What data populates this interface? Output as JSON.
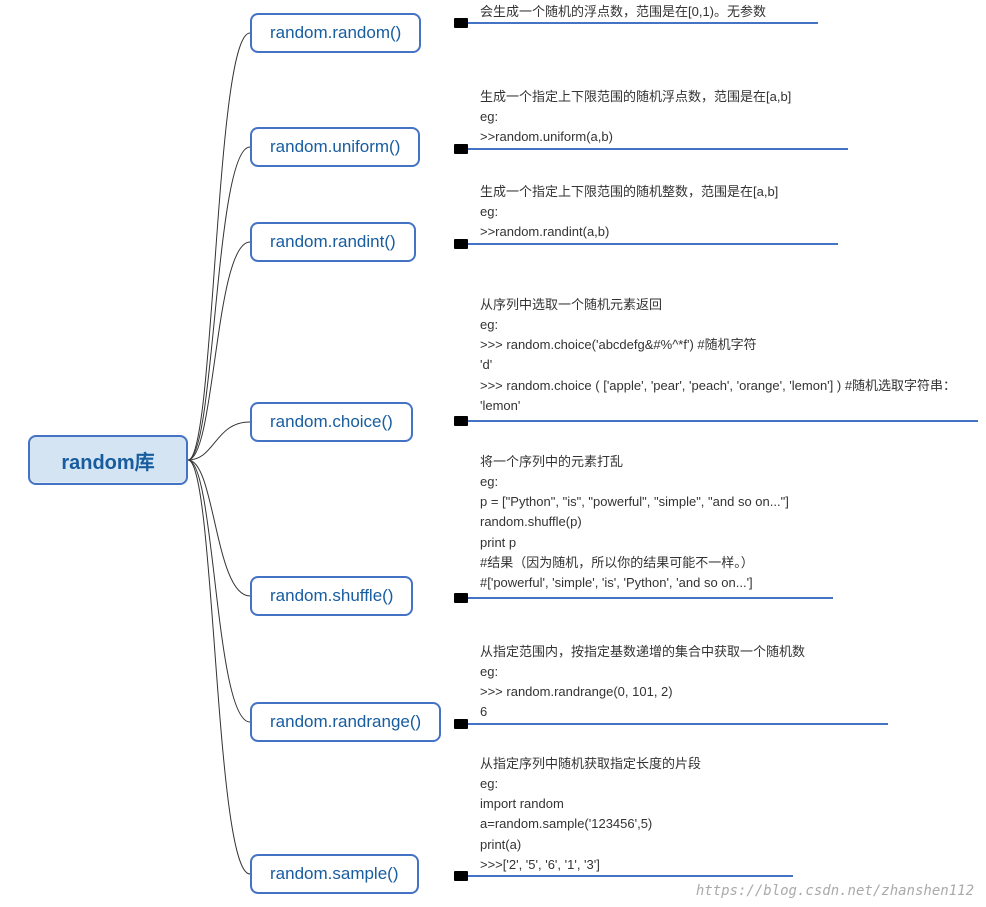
{
  "root": {
    "label": "random库"
  },
  "functions": [
    {
      "name": "random.random()"
    },
    {
      "name": "random.uniform()"
    },
    {
      "name": "random.randint()"
    },
    {
      "name": "random.choice()"
    },
    {
      "name": "random.shuffle()"
    },
    {
      "name": "random.randrange()"
    },
    {
      "name": "random.sample()"
    }
  ],
  "descriptions": {
    "random": "会生成一个随机的浮点数，范围是在[0,1)。无参数",
    "uniform": "生成一个指定上下限范围的随机浮点数，范围是在[a,b]\neg:\n>>random.uniform(a,b)",
    "randint": "生成一个指定上下限范围的随机整数，范围是在[a,b]\neg:\n>>random.randint(a,b)",
    "choice": "从序列中选取一个随机元素返回\neg:\n>>> random.choice('abcdefg&#%^*f') #随机字符\n'd'\n>>> random.choice ( ['apple', 'pear', 'peach', 'orange', 'lemon'] ) #随机选取字符串：\n'lemon'",
    "shuffle": "将一个序列中的元素打乱\neg:\np = [\"Python\", \"is\", \"powerful\", \"simple\", \"and so on...\"]\nrandom.shuffle(p)\nprint p\n#结果（因为随机，所以你的结果可能不一样。）\n#['powerful', 'simple', 'is', 'Python', 'and so on...']",
    "randrange": "从指定范围内，按指定基数递增的集合中获取一个随机数\neg:\n>>> random.randrange(0, 101, 2)\n6",
    "sample": "从指定序列中随机获取指定长度的片段\neg:\nimport random\na=random.sample('123456',5)\nprint(a)\n>>>['2', '5', '6', '1', '3']"
  },
  "watermark": "https://blog.csdn.net/zhanshen112"
}
